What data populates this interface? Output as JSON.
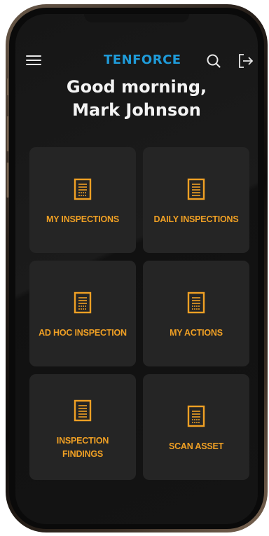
{
  "app": {
    "brand": "TENFORCE",
    "greeting_line1": "Good morning,",
    "greeting_line2": "Mark Johnson"
  },
  "header": {
    "menu_icon": "hamburger-menu-icon",
    "search_icon": "search-icon",
    "logout_icon": "logout-icon"
  },
  "tiles": [
    {
      "label": "MY INSPECTIONS",
      "icon": "document-icon"
    },
    {
      "label": "DAILY INSPECTIONS",
      "icon": "document-icon"
    },
    {
      "label": "AD HOC INSPECTION",
      "icon": "document-icon"
    },
    {
      "label": "MY ACTIONS",
      "icon": "document-icon"
    },
    {
      "label_line1": "INSPECTION",
      "label_line2": "FINDINGS",
      "icon": "document-icon"
    },
    {
      "label": "SCAN ASSET",
      "icon": "document-icon"
    }
  ],
  "colors": {
    "brand": "#1f9bd9",
    "accent": "#f0a024",
    "background": "#161616",
    "tile": "#252525",
    "text": "#f4f4f4"
  }
}
